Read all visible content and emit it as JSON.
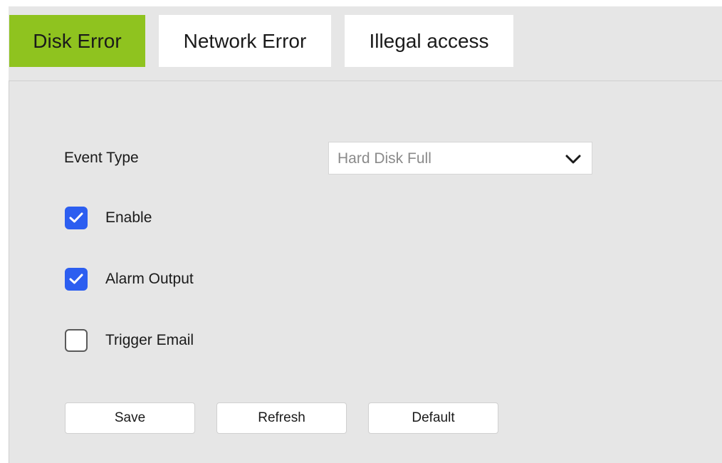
{
  "tabs": [
    {
      "label": "Disk Error",
      "active": true
    },
    {
      "label": "Network Error",
      "active": false
    },
    {
      "label": "Illegal access",
      "active": false
    }
  ],
  "colors": {
    "active_tab": "#8fc31f",
    "checkbox_checked": "#2c5ef0",
    "panel_bg": "#e6e6e6"
  },
  "form": {
    "event_type_label": "Event Type",
    "event_type_value": "Hard Disk Full",
    "enable": {
      "label": "Enable",
      "checked": true
    },
    "alarm_output": {
      "label": "Alarm Output",
      "checked": true
    },
    "trigger_email": {
      "label": "Trigger Email",
      "checked": false
    }
  },
  "buttons": {
    "save": "Save",
    "refresh": "Refresh",
    "default": "Default"
  },
  "icons": {
    "select_arrow": "chevron-down-icon",
    "checkmark": "checkmark-icon"
  }
}
